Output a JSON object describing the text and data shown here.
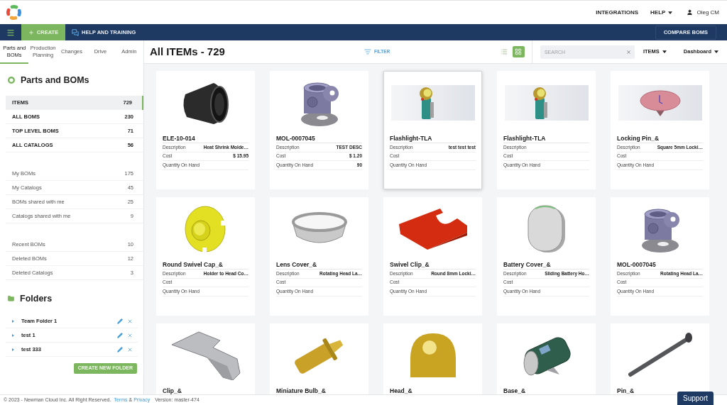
{
  "header": {
    "links": [
      {
        "label": "INTEGRATIONS",
        "kind": "link"
      },
      {
        "label": "HELP",
        "kind": "menu"
      }
    ],
    "user": "Oleg CM"
  },
  "navbar": {
    "create": "CREATE",
    "help_training": "HELP AND TRAINING",
    "compare": "COMPARE BOMS"
  },
  "sidebar": {
    "tabs": [
      {
        "label": "Parts and BOMs",
        "selected": true
      },
      {
        "label": "Production Planning",
        "selected": false
      },
      {
        "label": "Changes",
        "selected": false
      },
      {
        "label": "Drive",
        "selected": false
      },
      {
        "label": "Admin",
        "selected": false
      }
    ],
    "title": "Parts and BOMs",
    "groups": [
      {
        "kind": "primary",
        "items": [
          {
            "label": "ITEMS",
            "count": "729",
            "selected": true
          },
          {
            "label": "ALL BOMS",
            "count": "230",
            "selected": false
          },
          {
            "label": "TOP LEVEL BOMS",
            "count": "71",
            "selected": false
          },
          {
            "label": "ALL CATALOGS",
            "count": "56",
            "selected": false
          }
        ]
      },
      {
        "kind": "secondary",
        "items": [
          {
            "label": "My BOMs",
            "count": "175",
            "selected": false
          },
          {
            "label": "My Catalogs",
            "count": "45",
            "selected": false
          },
          {
            "label": "BOMs shared with me",
            "count": "25",
            "selected": false
          },
          {
            "label": "Catalogs shared with me",
            "count": "9",
            "selected": false
          }
        ]
      },
      {
        "kind": "secondary",
        "items": [
          {
            "label": "Recent BOMs",
            "count": "10",
            "selected": false
          },
          {
            "label": "Deleted BOMs",
            "count": "12",
            "selected": false
          },
          {
            "label": "Deleted Catalogs",
            "count": "3",
            "selected": false
          }
        ]
      }
    ],
    "folders": {
      "title": "Folders",
      "items": [
        {
          "name": "Team Folder 1"
        },
        {
          "name": "test 1"
        },
        {
          "name": "test 333"
        }
      ],
      "create_button": "CREATE NEW FOLDER"
    }
  },
  "toolbar": {
    "title": "All ITEMs - 729",
    "filter": "FILTER",
    "views": [
      {
        "kind": "list",
        "selected": false
      },
      {
        "kind": "grid",
        "selected": true
      }
    ],
    "search": {
      "placeholder": "SEARCH"
    },
    "type_menu": "ITEMS",
    "dashboard_menu": "Dashboard"
  },
  "cards": [
    {
      "title": "ELE-10-014",
      "selected": false,
      "fields": [
        {
          "label": "Description",
          "value": "Heat Shrink Molde…"
        },
        {
          "label": "Cost",
          "value": "$ 15.95"
        },
        {
          "label": "Quantity On Hand"
        }
      ]
    },
    {
      "title": "MOL-0007045",
      "selected": false,
      "fields": [
        {
          "label": "Description",
          "value": "TEST DESC"
        },
        {
          "label": "Cost",
          "value": "$ 1.20"
        },
        {
          "label": "Quantity On Hand",
          "value": "90"
        }
      ]
    },
    {
      "title": "Flashlight-TLA",
      "selected": true,
      "fields": [
        {
          "label": "Description",
          "value": "test test test"
        },
        {
          "label": "Cost"
        },
        {
          "label": "Quantity On Hand"
        }
      ]
    },
    {
      "title": "Flashlight-TLA",
      "selected": false,
      "fields": [
        {
          "label": "Description"
        },
        {
          "label": "Cost"
        },
        {
          "label": "Quantity On Hand"
        }
      ]
    },
    {
      "title": "Locking Pin_&",
      "selected": false,
      "fields": [
        {
          "label": "Description",
          "value": "Square 5mm Locki…"
        },
        {
          "label": "Cost"
        },
        {
          "label": "Quantity On Hand"
        }
      ]
    },
    {
      "title": "Round Swivel Cap_&",
      "selected": false,
      "fields": [
        {
          "label": "Description",
          "value": "Holder to Head Co…"
        },
        {
          "label": "Cost"
        },
        {
          "label": "Quantity On Hand"
        }
      ]
    },
    {
      "title": "Lens Cover_&",
      "selected": false,
      "fields": [
        {
          "label": "Description",
          "value": "Rotating Head La…"
        },
        {
          "label": "Cost"
        },
        {
          "label": "Quantity On Hand"
        }
      ]
    },
    {
      "title": "Swivel Clip_&",
      "selected": false,
      "fields": [
        {
          "label": "Description",
          "value": "Round 8mm Locki…"
        },
        {
          "label": "Cost"
        },
        {
          "label": "Quantity On Hand"
        }
      ]
    },
    {
      "title": "Battery Cover_&",
      "selected": false,
      "fields": [
        {
          "label": "Description",
          "value": "Sliding Battery Ho…"
        },
        {
          "label": "Cost"
        },
        {
          "label": "Quantity On Hand"
        }
      ]
    },
    {
      "title": "MOL-0007045",
      "selected": false,
      "fields": [
        {
          "label": "Description",
          "value": "Rotating Head La…"
        },
        {
          "label": "Cost"
        },
        {
          "label": "Quantity On Hand"
        }
      ]
    },
    {
      "title": "Clip_&",
      "selected": false
    },
    {
      "title": "Miniature Bulb_&",
      "selected": false
    },
    {
      "title": "Head_&",
      "selected": false
    },
    {
      "title": "Base_&",
      "selected": false
    },
    {
      "title": "Pin_&",
      "selected": false
    }
  ],
  "footer": {
    "copyright": "© 2023 - Newman Cloud Inc. All Right Reserved.",
    "terms": "Terms",
    "separator": "&",
    "privacy": "Privacy",
    "version": "Version: master-474"
  },
  "support": "Support"
}
